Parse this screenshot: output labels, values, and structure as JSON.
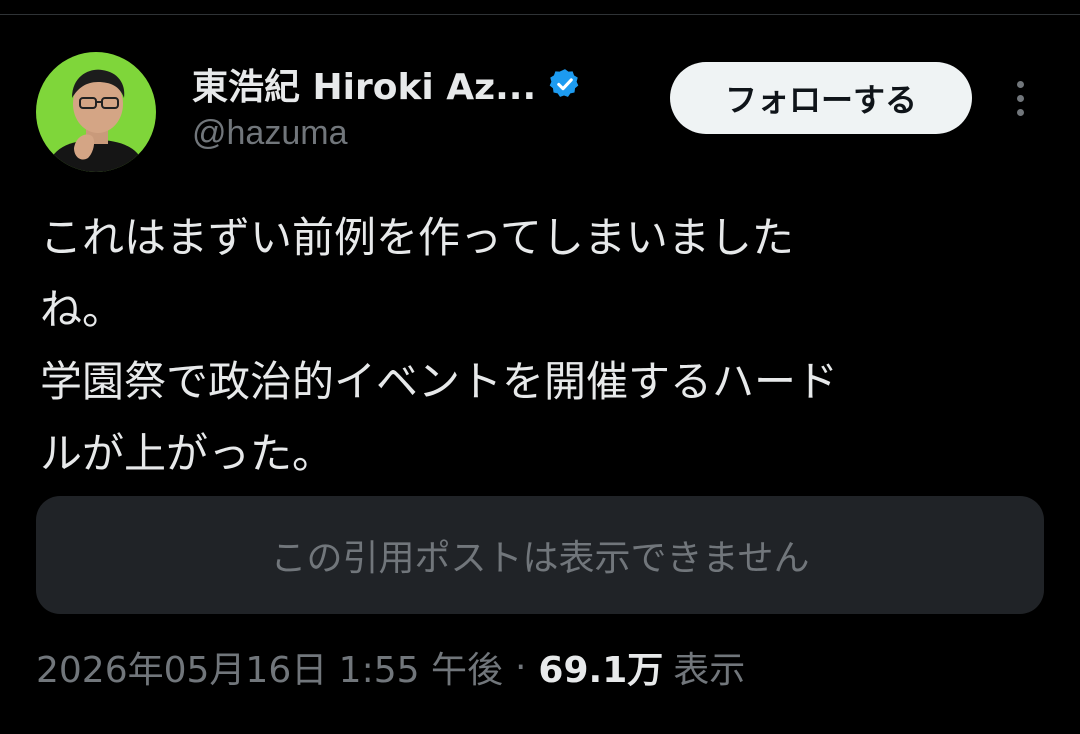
{
  "author": {
    "display_name": "東浩紀 Hiroki Az...",
    "handle": "@hazuma",
    "verified_icon": "verified-badge-icon",
    "avatar_bg_color": "#7fd63a"
  },
  "actions": {
    "follow_label": "フォローする",
    "more_icon": "more-vertical-icon"
  },
  "tweet": {
    "lines": [
      "これはまずい前例を作ってしまいました",
      "ね。",
      "学園祭で政治的イベントを開催するハード",
      "ルが上がった。"
    ]
  },
  "quote": {
    "unavailable_text": "この引用ポストは表示できません"
  },
  "meta": {
    "timestamp": "2026年05月16日 1:55 午後",
    "separator": "·",
    "views_count": "69.1万",
    "views_label": "表示"
  },
  "colors": {
    "background": "#000000",
    "text_primary": "#e7e9ea",
    "text_secondary": "#71767b",
    "verified_blue": "#1d9bf0",
    "quote_bg": "#202327",
    "follow_bg": "#eff3f4"
  }
}
